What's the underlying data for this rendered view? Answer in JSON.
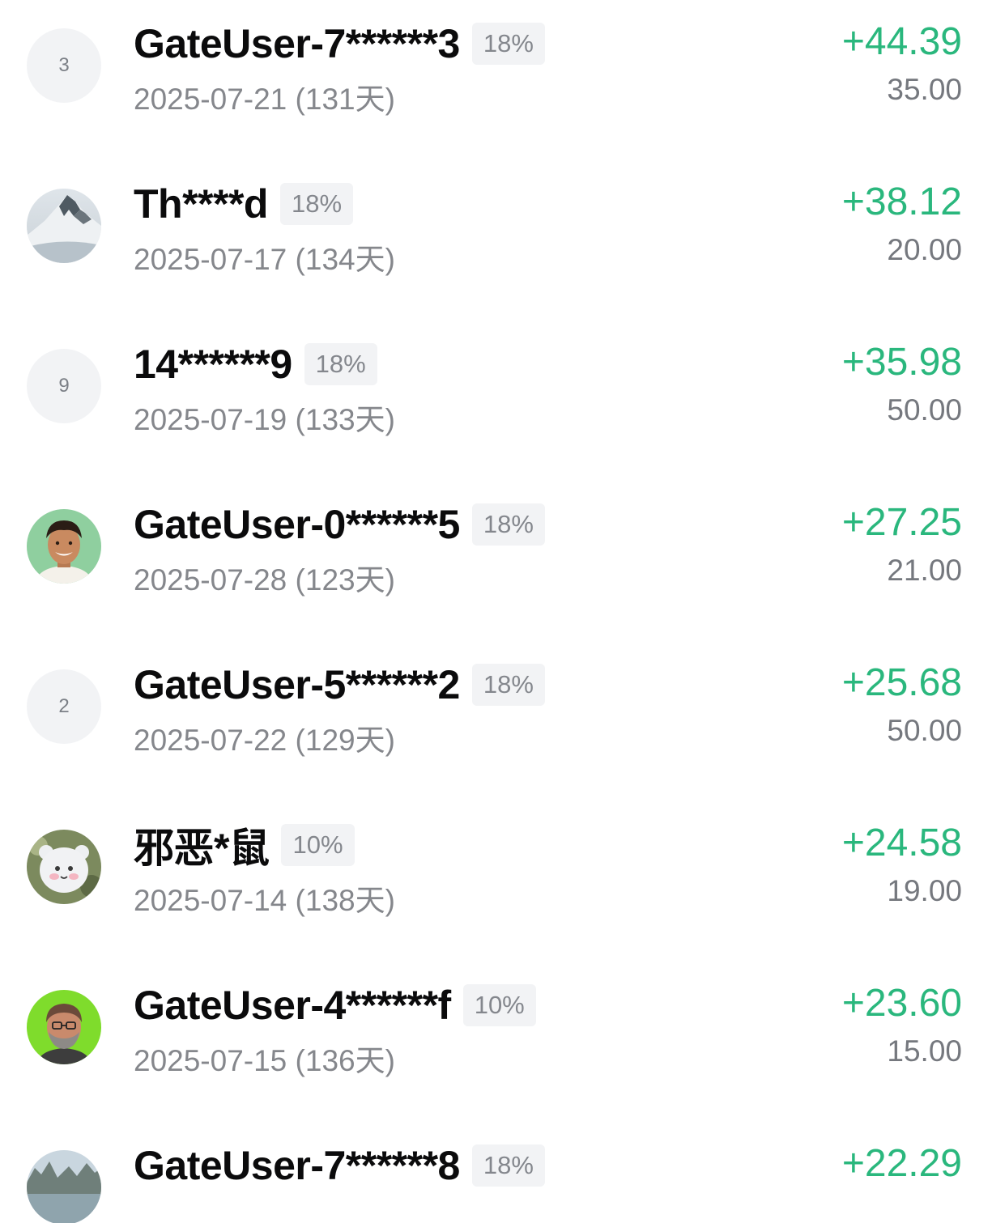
{
  "rows": [
    {
      "avatar_type": "number",
      "avatar_icon": "avatar-placeholder-icon",
      "avatar_text": "3",
      "name": "GateUser-7******3",
      "percent": "18%",
      "date": "2025-07-21 (131天)",
      "gain": "+44.39",
      "amount": "35.00"
    },
    {
      "avatar_type": "image",
      "avatar_icon": "snowy-mountain-avatar-icon",
      "avatar_text": "",
      "name": "Th****d",
      "percent": "18%",
      "date": "2025-07-17 (134天)",
      "gain": "+38.12",
      "amount": "20.00"
    },
    {
      "avatar_type": "number",
      "avatar_icon": "avatar-placeholder-icon",
      "avatar_text": "9",
      "name": "14******9",
      "percent": "18%",
      "date": "2025-07-19 (133天)",
      "gain": "+35.98",
      "amount": "50.00"
    },
    {
      "avatar_type": "image",
      "avatar_icon": "smiling-man-avatar-icon",
      "avatar_text": "",
      "name": "GateUser-0******5",
      "percent": "18%",
      "date": "2025-07-28 (123天)",
      "gain": "+27.25",
      "amount": "21.00"
    },
    {
      "avatar_type": "number",
      "avatar_icon": "avatar-placeholder-icon",
      "avatar_text": "2",
      "name": "GateUser-5******2",
      "percent": "18%",
      "date": "2025-07-22 (129天)",
      "gain": "+25.68",
      "amount": "50.00"
    },
    {
      "avatar_type": "image",
      "avatar_icon": "plush-toy-avatar-icon",
      "avatar_text": "",
      "name": "邪恶*鼠",
      "percent": "10%",
      "date": "2025-07-14 (138天)",
      "gain": "+24.58",
      "amount": "19.00"
    },
    {
      "avatar_type": "image",
      "avatar_icon": "bearded-man-avatar-icon",
      "avatar_text": "",
      "name": "GateUser-4******f",
      "percent": "10%",
      "date": "2025-07-15 (136天)",
      "gain": "+23.60",
      "amount": "15.00"
    },
    {
      "avatar_type": "image",
      "avatar_icon": "lake-landscape-avatar-icon",
      "avatar_text": "",
      "name": "GateUser-7******8",
      "percent": "18%",
      "date": "",
      "gain": "+22.29",
      "amount": ""
    }
  ],
  "colors": {
    "gain": "#2ab77d",
    "name": "#0b0b0c",
    "muted": "#85878c",
    "badge_bg": "#f2f3f5"
  }
}
